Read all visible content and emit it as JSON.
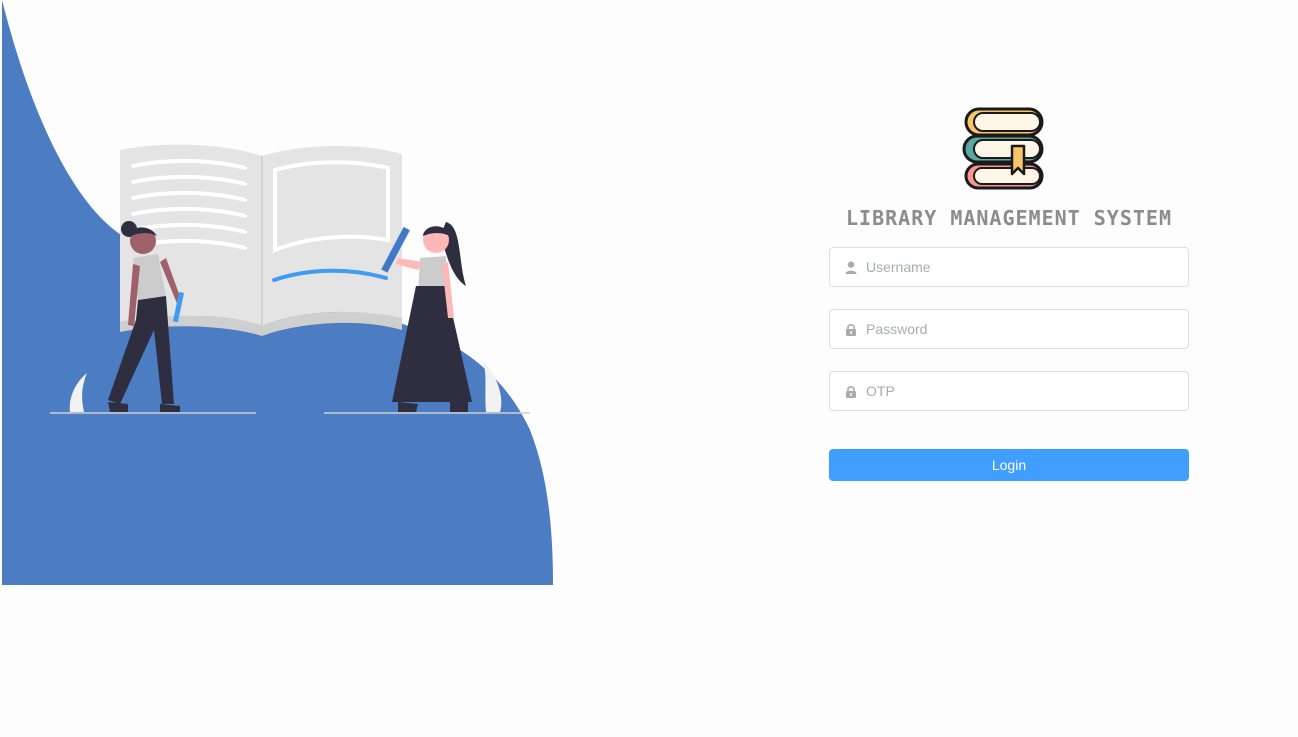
{
  "app": {
    "title": "LIBRARY MANAGEMENT SYSTEM"
  },
  "colors": {
    "hero_blue": "#4c7cc2",
    "button_primary": "#409eff",
    "title_gray": "#8c8c8c",
    "input_border": "#dcdfe6"
  },
  "form": {
    "username": {
      "placeholder": "Username",
      "value": "",
      "icon": "user-icon"
    },
    "password": {
      "placeholder": "Password",
      "value": "",
      "icon": "lock-icon"
    },
    "otp": {
      "placeholder": "OTP",
      "value": "",
      "icon": "lock-icon"
    },
    "login_label": "Login"
  },
  "images": {
    "hero": "illustration of two people drawing in a giant open book",
    "logo": "stack-of-books-icon"
  }
}
